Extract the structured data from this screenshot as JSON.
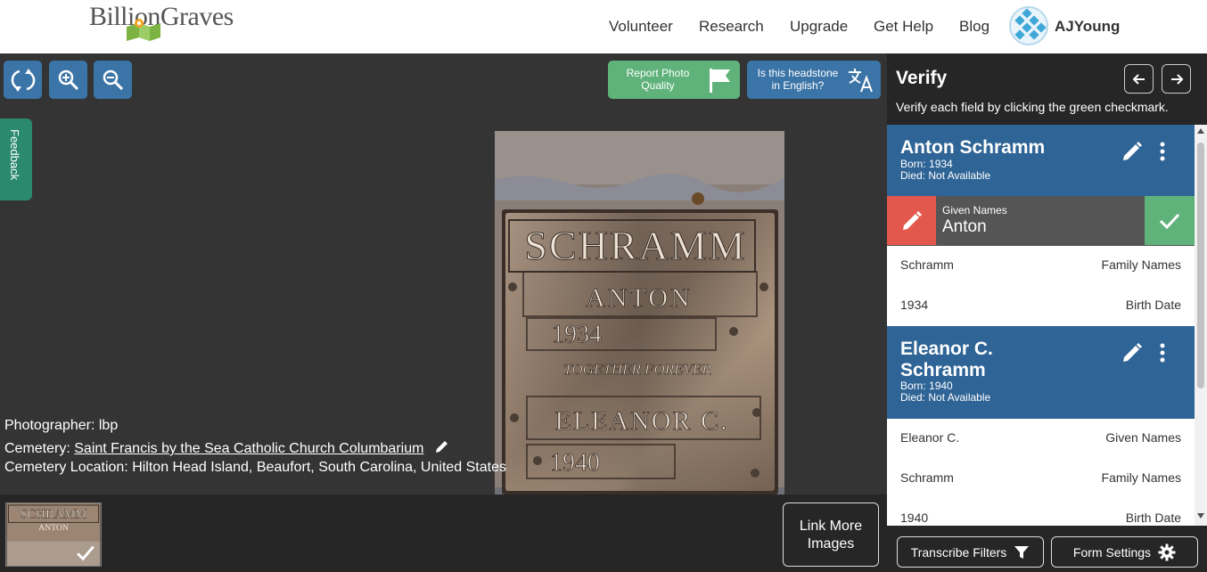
{
  "header": {
    "logo": "BillionGraves",
    "nav": [
      "Volunteer",
      "Research",
      "Upgrade",
      "Get Help",
      "Blog"
    ],
    "username": "AJYoung"
  },
  "viewer": {
    "report_label": "Report Photo Quality",
    "english_label": "Is this headstone in English?",
    "feedback_label": "Feedback",
    "photographer_label": "Photographer:",
    "photographer": "lbp",
    "cemetery_label": "Cemetery:",
    "cemetery": "Saint Francis by the Sea Catholic Church Columbarium",
    "location_label": "Cemetery Location:",
    "location": "Hilton Head Island, Beaufort, South Carolina, United States",
    "link_more": "Link More Images",
    "headstone_text": {
      "surname": "SCHRAMM",
      "first": "ANTON",
      "year1": "1934",
      "motto": "TOGETHER FOREVER",
      "second": "ELEANOR C.",
      "year2": "1940"
    }
  },
  "panel": {
    "title": "Verify",
    "subtitle": "Verify each field by clicking the green checkmark.",
    "persons": [
      {
        "name": "Anton Schramm",
        "born": "Born: 1934",
        "died": "Died: Not Available",
        "active_field": {
          "label": "Given Names",
          "value": "Anton"
        },
        "fields": [
          {
            "value": "Schramm",
            "key": "Family Names"
          },
          {
            "value": "1934",
            "key": "Birth Date"
          }
        ]
      },
      {
        "name_line1": "Eleanor C.",
        "name_line2": "Schramm",
        "born": "Born: 1940",
        "died": "Died: Not Available",
        "fields": [
          {
            "value": "Eleanor C.",
            "key": "Given Names"
          },
          {
            "value": "Schramm",
            "key": "Family Names"
          },
          {
            "value": "1940",
            "key": "Birth Date"
          }
        ]
      }
    ],
    "transcribe_filters": "Transcribe Filters",
    "form_settings": "Form Settings"
  },
  "colors": {
    "accent_blue": "#3b74a7",
    "person_header": "#2f6496",
    "green": "#5fb27a",
    "red": "#e3584c",
    "feedback_green": "#2b8a6d"
  }
}
